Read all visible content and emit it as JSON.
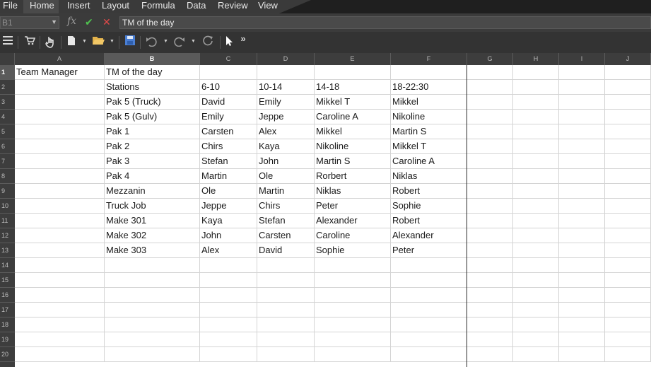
{
  "menu": {
    "items": [
      "File",
      "Home",
      "Insert",
      "Layout",
      "Formula",
      "Data",
      "Review",
      "View"
    ],
    "active": "Home"
  },
  "formula_bar": {
    "cell_ref": "B1",
    "fx_symbol": "fx",
    "accept_symbol": "✔",
    "cancel_symbol": "✕",
    "value": "TM of the day"
  },
  "toolbar": {
    "icons": [
      "menu-lines-icon",
      "cart-icon",
      "touch-hand-icon",
      "new-document-icon",
      "open-folder-icon",
      "save-icon",
      "undo-icon",
      "redo-icon",
      "repeat-icon",
      "pointer-icon",
      "overflow-chevron-icon"
    ]
  },
  "grid": {
    "columns": [
      "A",
      "B",
      "C",
      "D",
      "E",
      "F",
      "G",
      "H",
      "I",
      "J"
    ],
    "selected_column": "B",
    "rows": [
      "1",
      "2",
      "3",
      "4",
      "5",
      "6",
      "7",
      "8",
      "9",
      "10",
      "11",
      "12",
      "13",
      "14",
      "15",
      "16",
      "17",
      "18",
      "19",
      "20"
    ],
    "selected_row": "1",
    "data": [
      [
        "Team Manager",
        "TM of the day",
        "",
        "",
        "",
        ""
      ],
      [
        "",
        "Stations",
        "6-10",
        "10-14",
        "14-18",
        "18-22:30"
      ],
      [
        "",
        "Pak 5 (Truck)",
        "David",
        "Emily",
        "Mikkel T",
        "Mikkel"
      ],
      [
        "",
        "Pak 5 (Gulv)",
        "Emily",
        "Jeppe",
        "Caroline A",
        "Nikoline"
      ],
      [
        "",
        "Pak 1",
        "Carsten",
        "Alex",
        "Mikkel",
        "Martin S"
      ],
      [
        "",
        "Pak 2",
        "Chirs",
        "Kaya",
        "Nikoline",
        "Mikkel T"
      ],
      [
        "",
        "Pak 3",
        "Stefan",
        "John",
        "Martin S",
        "Caroline A"
      ],
      [
        "",
        "Pak 4",
        "Martin",
        "Ole",
        "Rorbert",
        "Niklas"
      ],
      [
        "",
        "Mezzanin",
        "Ole",
        "Martin",
        "Niklas",
        "Robert"
      ],
      [
        "",
        "Truck Job",
        "Jeppe",
        "Chirs",
        "Peter",
        "Sophie"
      ],
      [
        "",
        "Make 301",
        "Kaya",
        "Stefan",
        "Alexander",
        "Robert"
      ],
      [
        "",
        "Make 302",
        "John",
        "Carsten",
        "Caroline",
        "Alexander"
      ],
      [
        "",
        "Make 303",
        "Alex",
        "David",
        "Sophie",
        "Peter"
      ]
    ]
  }
}
